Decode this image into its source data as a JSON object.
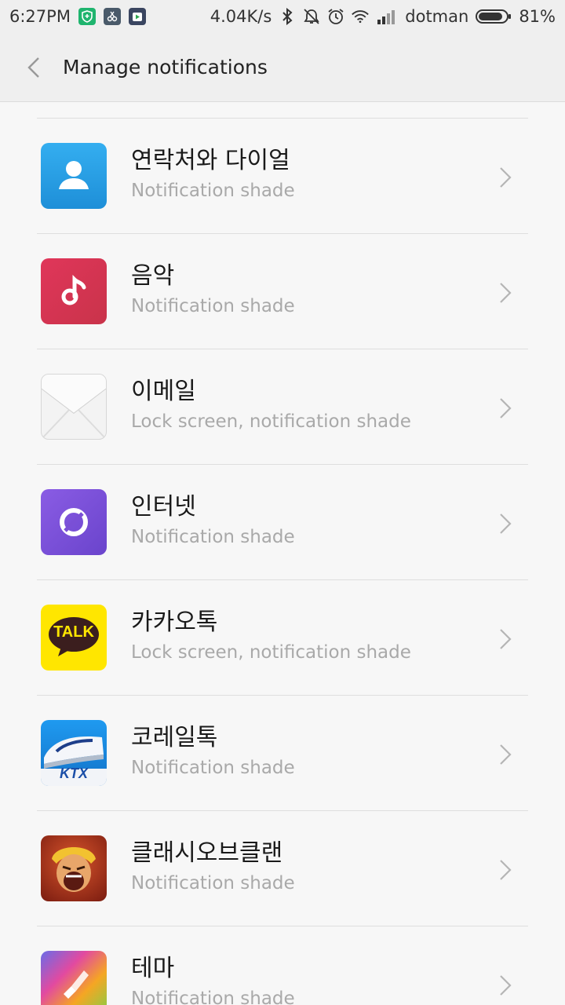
{
  "status_bar": {
    "time": "6:27PM",
    "speed": "4.04K/s",
    "carrier": "dotman",
    "battery": "81%"
  },
  "header": {
    "title": "Manage notifications"
  },
  "apps": [
    {
      "name": "연락처와 다이얼",
      "setting": "Notification shade",
      "icon": "contacts-icon"
    },
    {
      "name": "음악",
      "setting": "Notification shade",
      "icon": "music-icon"
    },
    {
      "name": "이메일",
      "setting": "Lock screen, notification shade",
      "icon": "email-icon"
    },
    {
      "name": "인터넷",
      "setting": "Notification shade",
      "icon": "browser-icon"
    },
    {
      "name": "카카오톡",
      "setting": "Lock screen, notification shade",
      "icon": "kakaotalk-icon",
      "icon_text": "TALK"
    },
    {
      "name": "코레일톡",
      "setting": "Notification shade",
      "icon": "korail-icon",
      "icon_text": "KTX"
    },
    {
      "name": "클래시오브클랜",
      "setting": "Notification shade",
      "icon": "clash-of-clans-icon"
    },
    {
      "name": "테마",
      "setting": "Notification shade",
      "icon": "themes-icon"
    }
  ],
  "colors": {
    "contacts": "#2a9ee0",
    "music": "#d83a57",
    "email": "#f1f1f1",
    "browser": "#7a4fd6",
    "kakaotalk": "#ffe600",
    "korail": "#1b8be0",
    "clash": "#b0341f"
  }
}
